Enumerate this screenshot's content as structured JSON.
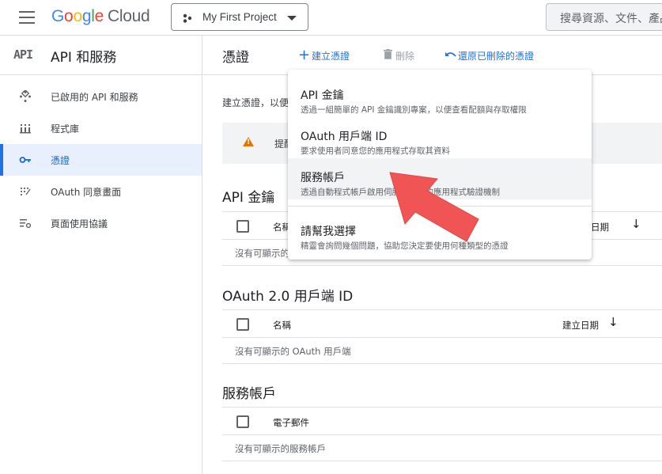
{
  "header": {
    "menu_icon": "hamburger-icon",
    "logo": {
      "g1": "G",
      "g2": "o",
      "g3": "o",
      "g4": "g",
      "g5": "l",
      "g6": "e",
      "cloud": "Cloud"
    },
    "project_name": "My First Project",
    "search_placeholder": "搜尋資源、文件、產品等"
  },
  "sidebar": {
    "api_badge": "API",
    "title": "API 和服務",
    "items": [
      {
        "label": "已啟用的 API 和服務",
        "icon": "api-diamond-icon"
      },
      {
        "label": "程式庫",
        "icon": "library-icon"
      },
      {
        "label": "憑證",
        "icon": "key-icon",
        "active": true
      },
      {
        "label": "OAuth 同意畫面",
        "icon": "dots-grid-icon"
      },
      {
        "label": "頁面使用協議",
        "icon": "settings-list-icon"
      }
    ]
  },
  "main": {
    "title": "憑證",
    "toolbar": {
      "create": "建立憑證",
      "delete": "刪除",
      "restore": "還原已刪除的憑證"
    },
    "intro": "建立憑證，以便",
    "banner_text": "提醒",
    "sections": {
      "api_keys": {
        "title": "API 金鑰",
        "col1": "名稱",
        "col2": "建立日期",
        "empty": "沒有可顯示的"
      },
      "oauth": {
        "title": "OAuth 2.0 用戶端 ID",
        "col1": "名稱",
        "col2": "建立日期",
        "empty": "沒有可顯示的 OAuth 用戶端"
      },
      "service_accounts": {
        "title": "服務帳戶",
        "col1": "電子郵件",
        "empty": "沒有可顯示的服務帳戶"
      }
    }
  },
  "menu": {
    "items": [
      {
        "title": "API 金鑰",
        "desc": "透過一組簡單的 API 金鑰識別專案，以便查看配額與存取權限"
      },
      {
        "title": "OAuth 用戶端 ID",
        "desc": "要求使用者同意您的應用程式存取其資料"
      },
      {
        "title": "服務帳戶",
        "desc": "透過自動程式帳戶啟用伺服器之間的應用程式驗證機制"
      },
      {
        "title": "請幫我選擇",
        "desc": "精靈會詢問幾個問題，協助您決定要使用何種類型的憑證"
      }
    ]
  },
  "colors": {
    "accent": "#1a73e8",
    "active_bg": "#e8f0fe",
    "warning": "#e37400",
    "annotation_arrow": "#f05454"
  }
}
